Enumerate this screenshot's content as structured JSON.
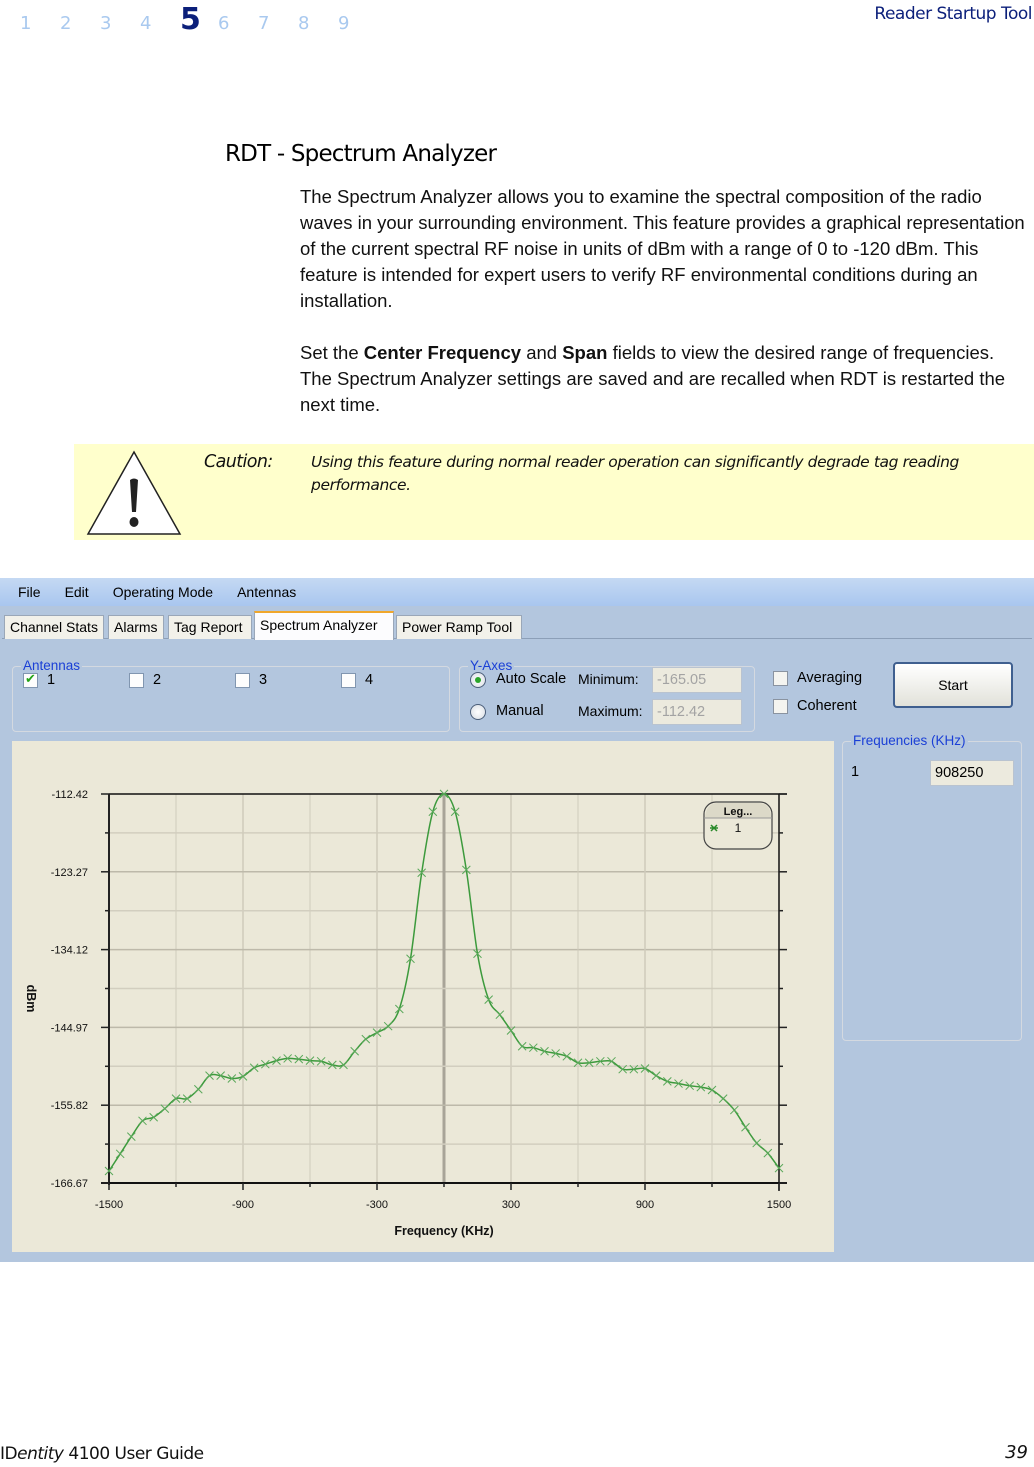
{
  "header": {
    "chapters": [
      "1",
      "2",
      "3",
      "4",
      "5",
      "6",
      "7",
      "8",
      "9"
    ],
    "current_chapter": "5",
    "running_head": "Reader Startup Tool"
  },
  "section": {
    "title": "RDT - Spectrum Analyzer",
    "para1": "The Spectrum Analyzer allows you to examine the spectral composition of the radio waves in your surrounding environment. This feature provides a graphical representation of the current spectral RF noise in units of dBm with a range of 0 to -120 dBm. This feature is intended for expert users to verify RF environmental conditions during an installation.",
    "para2_pre": "Set the ",
    "para2_bold1": "Center Frequency",
    "para2_mid": " and ",
    "para2_bold2": "Span",
    "para2_post": " fields to view the desired range of frequencies. The Spectrum Analyzer settings are saved and are recalled when RDT is restarted the next time."
  },
  "caution": {
    "label": "Caution:",
    "text": "Using this feature during normal reader operation can significantly degrade tag reading performance.",
    "icon": "warning-triangle-icon"
  },
  "app": {
    "menu": [
      "File",
      "Edit",
      "Operating Mode",
      "Antennas"
    ],
    "tabs": [
      {
        "label": "Channel Stats",
        "active": false
      },
      {
        "label": "Alarms",
        "active": false
      },
      {
        "label": "Tag Report",
        "active": false
      },
      {
        "label": "Spectrum Analyzer",
        "active": true
      },
      {
        "label": "Power Ramp Tool",
        "active": false
      }
    ],
    "antennas": {
      "legend": "Antennas",
      "items": [
        {
          "label": "1",
          "checked": true
        },
        {
          "label": "2",
          "checked": false
        },
        {
          "label": "3",
          "checked": false
        },
        {
          "label": "4",
          "checked": false
        }
      ]
    },
    "y_axes": {
      "legend": "Y-Axes",
      "auto_scale_label": "Auto Scale",
      "manual_label": "Manual",
      "selected": "Auto Scale",
      "minimum_label": "Minimum:",
      "minimum_value": "-165.05",
      "maximum_label": "Maximum:",
      "maximum_value": "-112.42"
    },
    "options": {
      "averaging_label": "Averaging",
      "averaging_checked": false,
      "coherent_label": "Coherent",
      "coherent_checked": false
    },
    "start_label": "Start",
    "frequencies": {
      "legend": "Frequencies (KHz)",
      "rows": [
        {
          "index": "1",
          "value": "908250"
        }
      ]
    }
  },
  "chart_data": {
    "type": "line",
    "title": "",
    "xlabel": "Frequency (KHz)",
    "ylabel": "dBm",
    "xlim": [
      -1500,
      1500
    ],
    "ylim": [
      -166.67,
      -112.42
    ],
    "x_ticks": [
      "-1500",
      "-900",
      "-300",
      "300",
      "900",
      "1500"
    ],
    "y_ticks": [
      "-112.42",
      "-123.27",
      "-134.12",
      "-144.97",
      "-155.82",
      "-166.67"
    ],
    "grid": true,
    "legend": {
      "title": "Leg...",
      "position": "top-right",
      "entries": [
        "1"
      ]
    },
    "series": [
      {
        "name": "1",
        "color": "#3c9a3c",
        "marker": "x",
        "x": [
          -1500,
          -1450,
          -1400,
          -1350,
          -1300,
          -1250,
          -1200,
          -1150,
          -1100,
          -1050,
          -1000,
          -950,
          -900,
          -850,
          -800,
          -750,
          -700,
          -650,
          -600,
          -550,
          -500,
          -450,
          -400,
          -350,
          -300,
          -250,
          -200,
          -150,
          -100,
          -50,
          0,
          50,
          100,
          150,
          200,
          250,
          300,
          350,
          400,
          450,
          500,
          550,
          600,
          650,
          700,
          750,
          800,
          850,
          900,
          950,
          1000,
          1050,
          1100,
          1150,
          1200,
          1250,
          1300,
          1350,
          1400,
          1450,
          1500
        ],
        "y": [
          -165.0,
          -162.6,
          -160.2,
          -158.0,
          -157.5,
          -156.3,
          -154.9,
          -154.9,
          -153.6,
          -151.7,
          -151.7,
          -152.1,
          -151.8,
          -150.6,
          -150.1,
          -149.6,
          -149.3,
          -149.4,
          -149.6,
          -149.7,
          -150.2,
          -150.2,
          -148.3,
          -146.6,
          -145.7,
          -144.8,
          -142.4,
          -135.4,
          -123.4,
          -114.9,
          -112.4,
          -114.9,
          -123.0,
          -134.7,
          -141.1,
          -143.2,
          -145.4,
          -147.6,
          -147.8,
          -148.3,
          -148.6,
          -149.0,
          -149.9,
          -149.9,
          -149.7,
          -149.7,
          -150.8,
          -150.8,
          -150.7,
          -151.7,
          -152.5,
          -152.8,
          -153.1,
          -153.3,
          -153.7,
          -154.9,
          -156.5,
          -158.9,
          -161.1,
          -162.5,
          -164.6
        ]
      }
    ]
  },
  "footer": {
    "guide_prefix": "ID",
    "guide_italic": "entity",
    "guide_suffix": " 4100 User Guide",
    "page_number": "39"
  }
}
